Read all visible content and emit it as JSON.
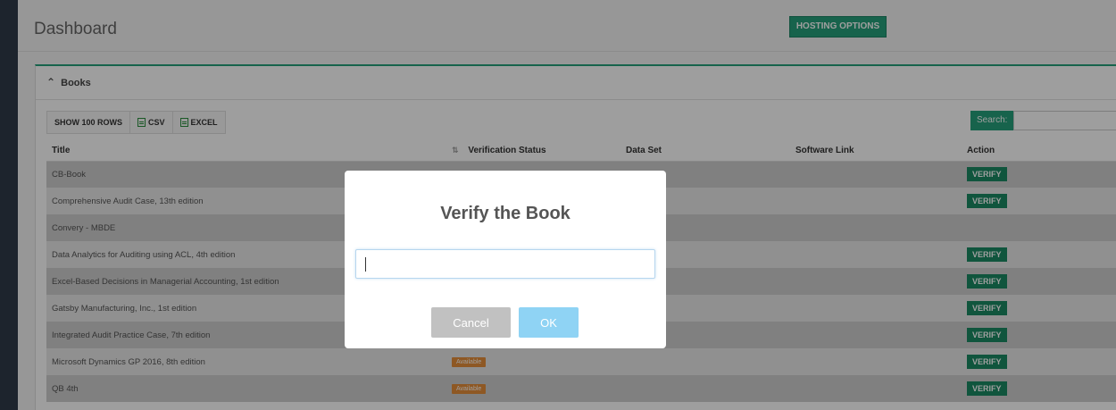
{
  "header": {
    "title": "Dashboard",
    "hosting_label": "HOSTING OPTIONS"
  },
  "panel": {
    "title": "Books"
  },
  "toolbar": {
    "show_rows": "SHOW 100 ROWS",
    "csv": "CSV",
    "excel": "EXCEL"
  },
  "search": {
    "label": "Search:",
    "value": ""
  },
  "table": {
    "columns": [
      "Title",
      "Verification Status",
      "Data Set",
      "Software Link",
      "Action"
    ],
    "rows": [
      {
        "title": "CB-Book",
        "status": "",
        "action": "VERIFY"
      },
      {
        "title": "Comprehensive Audit Case, 13th edition",
        "status": "",
        "action": "VERIFY"
      },
      {
        "title": "Convery - MBDE",
        "status": "",
        "action": ""
      },
      {
        "title": "Data Analytics for Auditing using ACL, 4th edition",
        "status": "",
        "action": "VERIFY"
      },
      {
        "title": "Excel-Based Decisions in Managerial Accounting, 1st edition",
        "status": "",
        "action": "VERIFY"
      },
      {
        "title": "Gatsby Manufacturing, Inc., 1st edition",
        "status": "",
        "action": "VERIFY"
      },
      {
        "title": "Integrated Audit Practice Case, 7th edition",
        "status": "",
        "action": "VERIFY"
      },
      {
        "title": "Microsoft Dynamics GP 2016, 8th edition",
        "status": "Available",
        "action": "VERIFY"
      },
      {
        "title": "QB 4th",
        "status": "Available",
        "action": "VERIFY"
      }
    ]
  },
  "modal": {
    "title": "Verify the Book",
    "input_value": "",
    "cancel_label": "Cancel",
    "ok_label": "OK"
  },
  "colors": {
    "accent": "#26a17b",
    "badge": "#e58f3a",
    "ok": "#8fd3f4",
    "cancel": "#c1c1c1"
  }
}
